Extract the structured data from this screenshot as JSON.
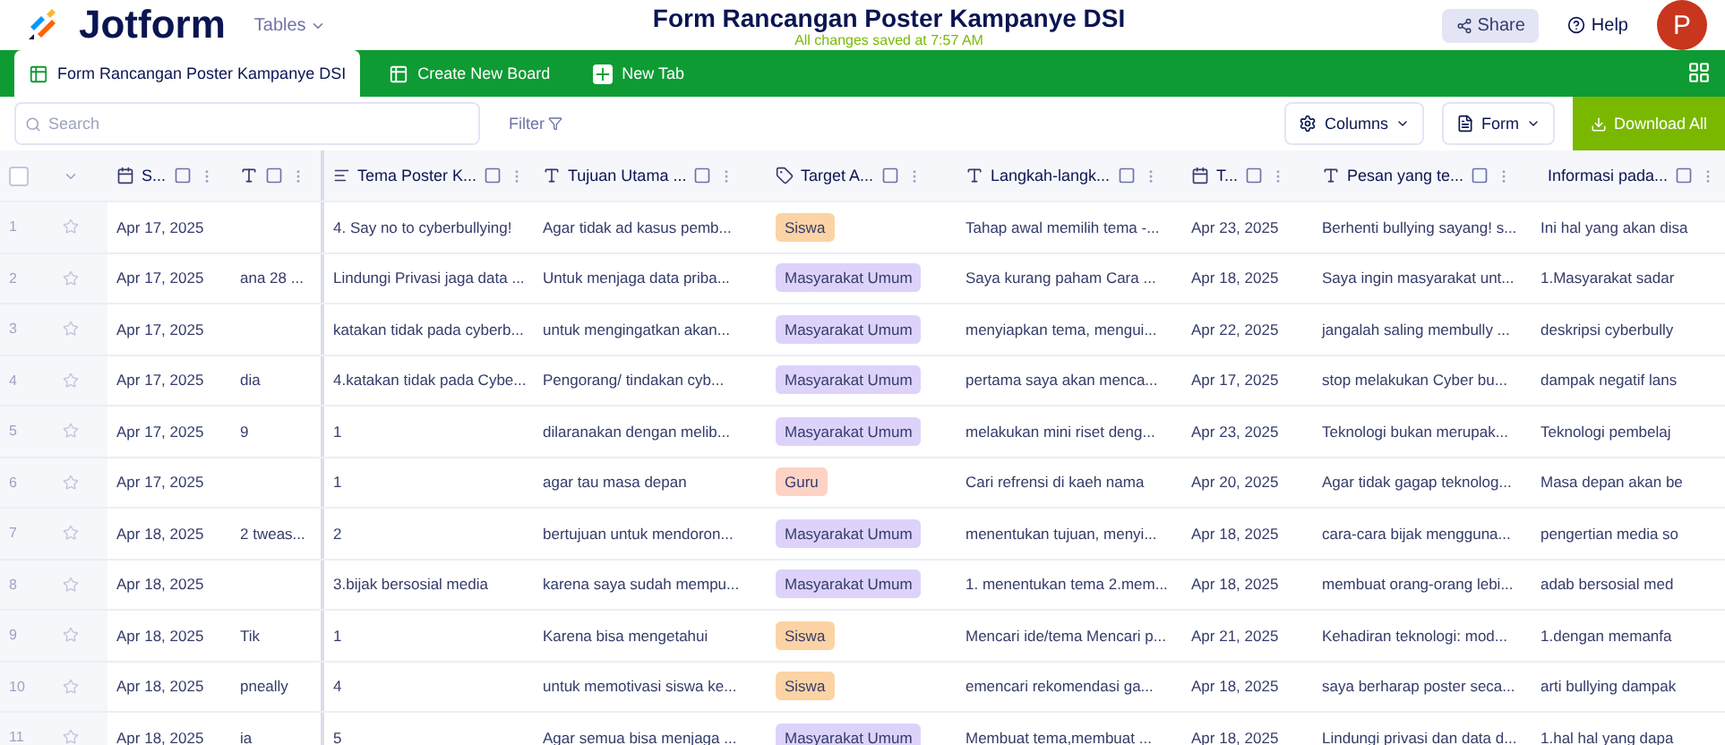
{
  "header": {
    "brand": "Jotform",
    "section": "Tables",
    "title": "Form Rancangan Poster Kampanye DSI",
    "subtitle": "All changes saved at 7:57 AM",
    "share": "Share",
    "help": "Help",
    "avatar": "P"
  },
  "tabs": [
    {
      "label": "Form Rancangan Poster Kampanye DSI",
      "selected": true
    },
    {
      "label": "Create New Board",
      "selected": false
    },
    {
      "label": "New Tab",
      "selected": false
    }
  ],
  "toolbar": {
    "search_placeholder": "Search",
    "filter": "Filter",
    "columns": "Columns",
    "form": "Form",
    "download": "Download All"
  },
  "table": {
    "select_all": {
      "checked": false
    },
    "columns": [
      {
        "kind": "date",
        "label": "S..."
      },
      {
        "kind": "text"
      },
      {
        "kind": "longtext",
        "label": "Tema Poster K..."
      },
      {
        "kind": "text",
        "label": "Tujuan Utama ..."
      },
      {
        "kind": "tag",
        "label": "Target A..."
      },
      {
        "kind": "text",
        "label": "Langkah-langk..."
      },
      {
        "kind": "date",
        "label": "T..."
      },
      {
        "kind": "text",
        "label": "Pesan yang te..."
      },
      {
        "kind": "text",
        "label": "Informasi pada..."
      }
    ],
    "rows": [
      {
        "number": "1",
        "cells": [
          "Apr 17, 2025",
          "",
          "4. Say no to cyberbullying!",
          "Agar tidak ad kasus pemb...",
          {
            "tag": "Siswa",
            "color": "#fbd3a4"
          },
          "Tahap awal memilih tema -...",
          "Apr 23, 2025",
          "Berhenti bullying sayang! s...",
          "Ini hal yang akan disa"
        ]
      },
      {
        "number": "2",
        "cells": [
          "Apr 17, 2025",
          "ana 28 ...",
          "Lindungi Privasi jaga data ...",
          "Untuk menjaga data priba...",
          {
            "tag": "Masyarakat Umum",
            "color": "#ddd3fa"
          },
          "Saya kurang paham Cara ...",
          "Apr 18, 2025",
          "Saya ingin masyarakat unt...",
          "1.Masyarakat sadar"
        ]
      },
      {
        "number": "3",
        "cells": [
          "Apr 17, 2025",
          "",
          "katakan tidak pada cyberb...",
          "untuk mengingatkan akan...",
          {
            "tag": "Masyarakat Umum",
            "color": "#ddd3fa"
          },
          "menyiapkan tema, mengui...",
          "Apr 22, 2025",
          "jangalah saling membully ...",
          "deskripsi cyberbully"
        ]
      },
      {
        "number": "4",
        "cells": [
          "Apr 17, 2025",
          "dia",
          "4.katakan tidak pada Cybe...",
          "Pengorang/ tindakan cyb...",
          {
            "tag": "Masyarakat Umum",
            "color": "#ddd3fa"
          },
          "pertama saya akan menca...",
          "Apr 17, 2025",
          "stop melakukan Cyber bu...",
          "dampak negatif lans"
        ]
      },
      {
        "number": "5",
        "cells": [
          "Apr 17, 2025",
          "9",
          "1",
          "dilaranakan dengan melib...",
          {
            "tag": "Masyarakat Umum",
            "color": "#ddd3fa"
          },
          "melakukan mini riset deng...",
          "Apr 23, 2025",
          "Teknologi bukan merupak...",
          "Teknologi pembelaj"
        ]
      },
      {
        "number": "6",
        "cells": [
          "Apr 17, 2025",
          "",
          "1",
          "agar tau masa depan",
          {
            "tag": "Guru",
            "color": "#fdd3c6"
          },
          "Cari refrensi di kaeh nama",
          "Apr 20, 2025",
          "Agar tidak gagap teknolog...",
          "Masa depan akan be"
        ]
      },
      {
        "number": "7",
        "cells": [
          "Apr 18, 2025",
          "2 tweas...",
          "2",
          "bertujuan untuk mendoron...",
          {
            "tag": "Masyarakat Umum",
            "color": "#ddd3fa"
          },
          "menentukan tujuan, menyi...",
          "Apr 18, 2025",
          "cara-cara bijak mengguna...",
          "pengertian media so"
        ]
      },
      {
        "number": "8",
        "cells": [
          "Apr 18, 2025",
          "",
          "3.bijak bersosial media",
          "karena saya sudah mempu...",
          {
            "tag": "Masyarakat Umum",
            "color": "#ddd3fa"
          },
          "1. menentukan tema 2.mem...",
          "Apr 18, 2025",
          "membuat orang-orang lebi...",
          "adab bersosial med"
        ]
      },
      {
        "number": "9",
        "cells": [
          "Apr 18, 2025",
          "Tik",
          "1",
          "Karena bisa mengetahui",
          {
            "tag": "Siswa",
            "color": "#fbd3a4"
          },
          "Mencari ide/tema Mencari p...",
          "Apr 21, 2025",
          "Kehadiran teknologi: mod...",
          "1.dengan memanfa"
        ]
      },
      {
        "number": "10",
        "cells": [
          "Apr 18, 2025",
          "pneally",
          "4",
          "untuk memotivasi siswa ke...",
          {
            "tag": "Siswa",
            "color": "#fbd3a4"
          },
          "emencari rekomendasi ga...",
          "Apr 18, 2025",
          "saya berharap poster seca...",
          "arti bullying dampak"
        ]
      },
      {
        "number": "11",
        "cells": [
          "Apr 18, 2025",
          "ia",
          "5",
          "Agar semua bisa menjaga ...",
          {
            "tag": "Masyarakat Umum",
            "color": "#ddd3fa"
          },
          "Membuat tema,membuat ...",
          "Apr 18, 2025",
          "Lindungi privasi dan data d...",
          "1.hal hal yang dapa"
        ]
      }
    ]
  }
}
